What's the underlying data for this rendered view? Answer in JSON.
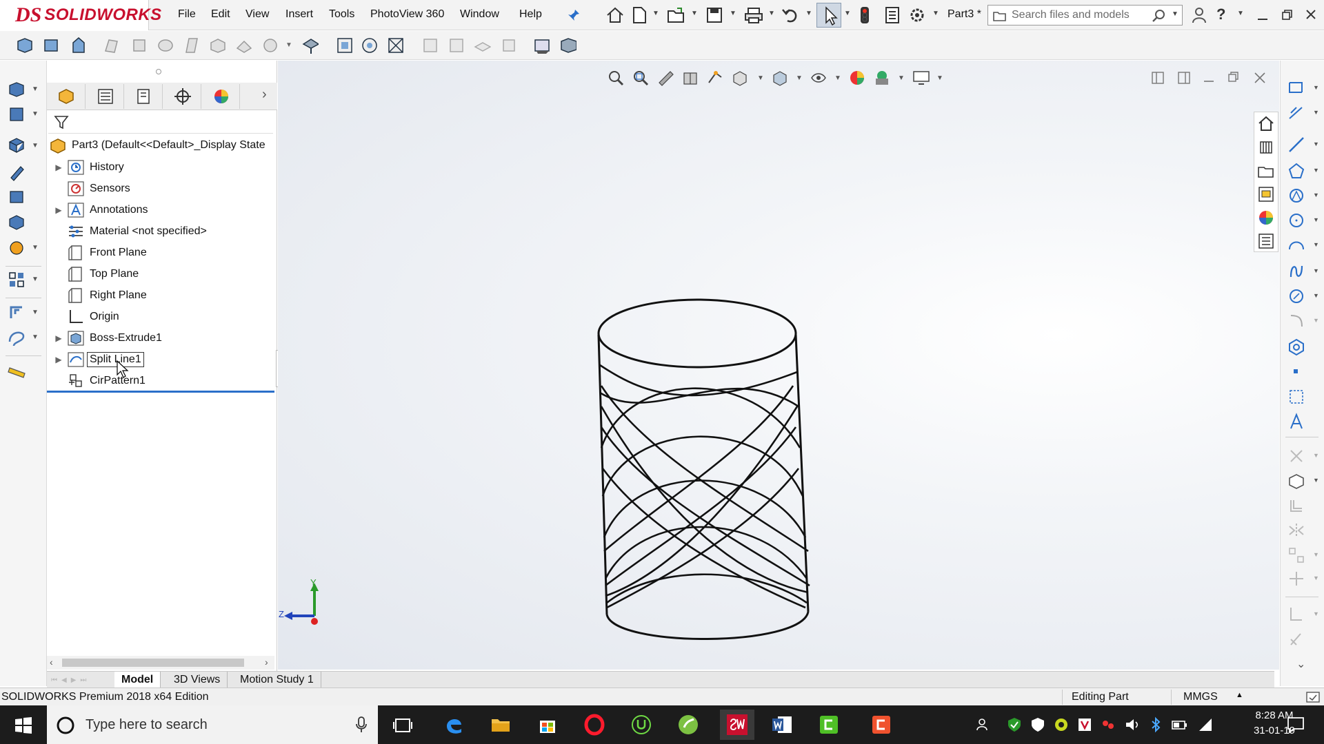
{
  "app": {
    "logo_prefix": "DS",
    "logo_name": "SOLIDWORKS",
    "document_title": "Part3 *",
    "brand_color": "#c8102e"
  },
  "menu": {
    "items": [
      "File",
      "Edit",
      "View",
      "Insert",
      "Tools",
      "PhotoView 360",
      "Window",
      "Help"
    ]
  },
  "search": {
    "placeholder": "Search files and models"
  },
  "feature_tree": {
    "root": "Part3  (Default<<Default>_Display State",
    "items": [
      {
        "label": "History",
        "expandable": true,
        "icon": "history-icon"
      },
      {
        "label": "Sensors",
        "expandable": false,
        "icon": "sensor-icon"
      },
      {
        "label": "Annotations",
        "expandable": true,
        "icon": "annotation-icon"
      },
      {
        "label": "Material <not specified>",
        "expandable": false,
        "icon": "material-icon"
      },
      {
        "label": "Front Plane",
        "expandable": false,
        "icon": "plane-icon"
      },
      {
        "label": "Top Plane",
        "expandable": false,
        "icon": "plane-icon"
      },
      {
        "label": "Right Plane",
        "expandable": false,
        "icon": "plane-icon"
      },
      {
        "label": "Origin",
        "expandable": false,
        "icon": "origin-icon"
      },
      {
        "label": "Boss-Extrude1",
        "expandable": true,
        "icon": "extrude-icon"
      },
      {
        "label": "Split Line1",
        "expandable": true,
        "icon": "split-line-icon",
        "selected": true
      },
      {
        "label": "CirPattern1",
        "expandable": false,
        "icon": "circular-pattern-icon"
      }
    ]
  },
  "bottom_tabs": [
    "Model",
    "3D Views",
    "Motion Study 1"
  ],
  "status": {
    "edition": "SOLIDWORKS Premium 2018 x64 Edition",
    "mode": "Editing Part",
    "units": "MMGS"
  },
  "triad": {
    "y_label": "Y",
    "z_label": "Z"
  },
  "taskbar": {
    "search_placeholder": "Type here to search",
    "time": "8:28 AM",
    "date": "31-01-19",
    "apps": [
      "edge-icon",
      "file-explorer-icon",
      "store-icon",
      "opera-icon",
      "upwork-icon",
      "app-green-icon",
      "solidworks-icon",
      "word-icon",
      "camtasia-icon",
      "camtasia-recorder-icon"
    ]
  }
}
